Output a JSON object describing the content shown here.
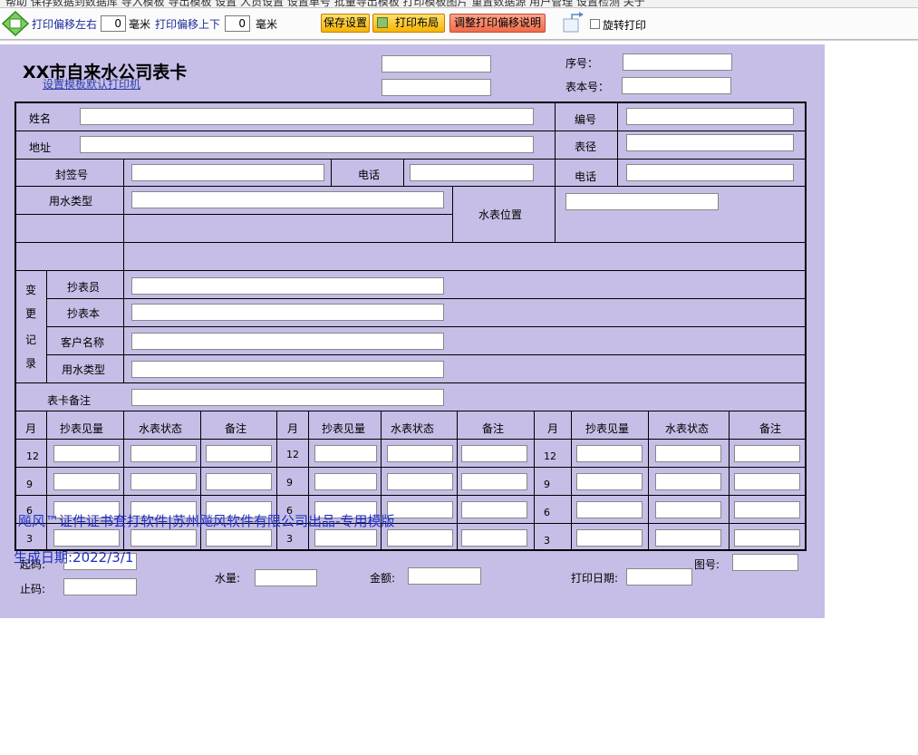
{
  "toolbar": {
    "top_strip_text": "帮助  保存数据到数据库  导入模板  导出模板      设置   人员设置  设置单号  批量导出模板   打印模板图片  重置数据源  用户管理  设置检测        关于",
    "offset_lr_label": "打印偏移左右",
    "offset_lr_value": "0",
    "offset_ud_label": "打印偏移上下",
    "offset_ud_value": "0",
    "unit_mm": "毫米",
    "save_btn": "保存设置",
    "layout_btn": "打印布局",
    "offset_help_btn": "调整打印偏移说明",
    "rotate_label": "旋转打印"
  },
  "card": {
    "title": "XX市自来水公司表卡",
    "set_printer_link": "设置模板默认打印机",
    "serial_label": "序号：",
    "meter_no_label": "表本号：",
    "name_label": "姓名",
    "address_label": "地址",
    "code_label": "编号",
    "meter_dia_label": "表径",
    "seal_label": "封签号",
    "phone_label": "电话",
    "phone_label2": "电话",
    "water_type_label": "用水类型",
    "meter_pos_label": "水表位置",
    "change_record_label": [
      "变",
      "更",
      "记",
      "录"
    ],
    "reader_label": "抄表员",
    "reading_book_label": "抄表本",
    "customer_name_label": "客户名称",
    "water_type2_label": "用水类型",
    "remark_label": "表卡备注",
    "table_headers": [
      "月",
      "抄表见量",
      "水表状态",
      "备注"
    ],
    "rows": [
      {
        "months": [
          "12",
          "12",
          "12"
        ]
      },
      {
        "months": [
          "9",
          "9",
          "9"
        ]
      },
      {
        "months": [
          "6",
          "6",
          "6"
        ]
      },
      {
        "months": [
          "3",
          "3",
          "3"
        ]
      }
    ],
    "watermark": "飚风™证件证书套打软件|苏州飚风软件有限公司出品-专用模版",
    "gen_date": "生成日期:2022/3/1",
    "start_code_label": "起码:",
    "end_code_label": "止码:",
    "water_amount_label": "水量:",
    "money_label": "金额:",
    "print_date_label": "打印日期:",
    "figure_no_label": "图号:"
  }
}
